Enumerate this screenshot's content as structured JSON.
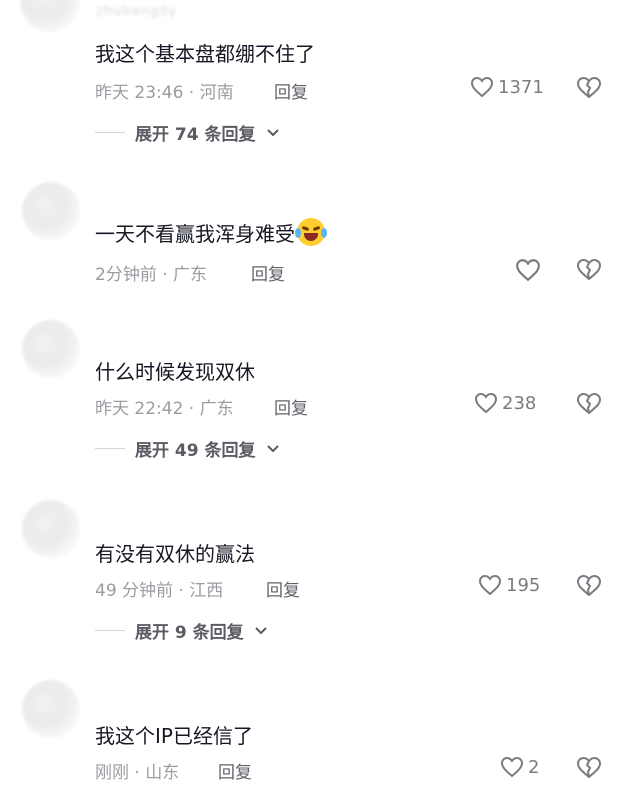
{
  "comments": [
    {
      "user": "zhubangdy",
      "text": "我这个基本盘都绷不住了",
      "time": "昨天 23:46",
      "location": "河南",
      "reply": "回复",
      "likes": "1371",
      "expand": "展开 74 条回复"
    },
    {
      "user": "",
      "text": "一天不看赢我浑身难受",
      "time": "2分钟前",
      "location": "广东",
      "reply": "回复",
      "likes": "",
      "expand": ""
    },
    {
      "user": "",
      "text": "什么时候发现双休",
      "time": "昨天 22:42",
      "location": "广东",
      "reply": "回复",
      "likes": "238",
      "expand": "展开 49 条回复"
    },
    {
      "user": "",
      "text": "有没有双休的赢法",
      "time": "49 分钟前",
      "location": "江西",
      "reply": "回复",
      "likes": "195",
      "expand": "展开 9 条回复"
    },
    {
      "user": "",
      "text": "我这个IP已经信了",
      "time": "刚刚",
      "location": "山东",
      "reply": "回复",
      "likes": "2",
      "expand": ""
    }
  ],
  "separator": " · ",
  "icons": {
    "like": "heart-outline-icon",
    "dislike": "broken-heart-icon",
    "expand": "chevron-down-icon",
    "emoji": "laughing-tears-emoji"
  },
  "colors": {
    "text": "#161823",
    "meta": "#9b9ca1",
    "icon": "#7b7c82"
  }
}
